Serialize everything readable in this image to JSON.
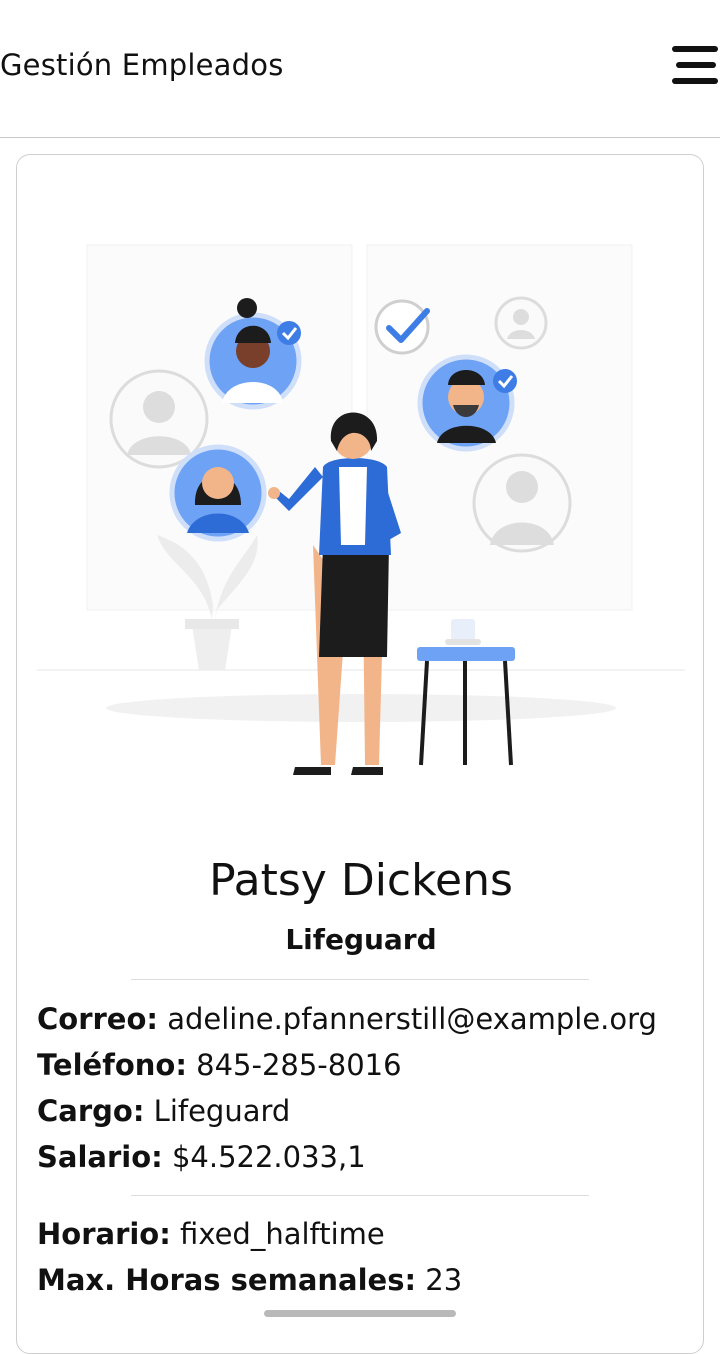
{
  "header": {
    "title": "Gestión Empleados",
    "menu_icon": "hamburger-menu-icon"
  },
  "employee": {
    "name": "Patsy Dickens",
    "role": "Lifeguard",
    "illustration": "team-management-illustration"
  },
  "details_primary": [
    {
      "label": "Correo:",
      "value": "adeline.pfannerstill@example.org"
    },
    {
      "label": "Teléfono:",
      "value": "845-285-8016"
    },
    {
      "label": "Cargo:",
      "value": "Lifeguard"
    },
    {
      "label": "Salario:",
      "value": "$4.522.033,1"
    }
  ],
  "details_secondary": [
    {
      "label": "Horario:",
      "value": "fixed_halftime"
    },
    {
      "label": "Max. Horas semanales:",
      "value": "23"
    }
  ],
  "colors": {
    "accent_blue": "#4f8ff7",
    "text": "#111111",
    "border": "#cfcfcf"
  }
}
